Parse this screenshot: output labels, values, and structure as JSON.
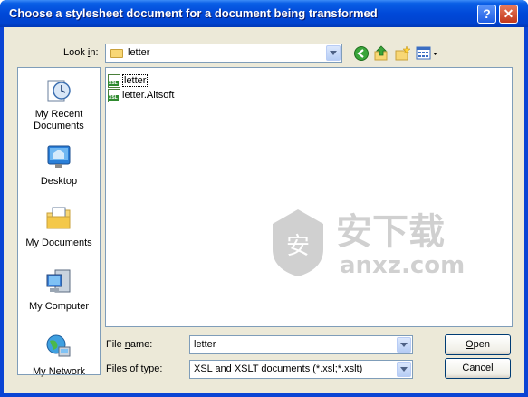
{
  "window": {
    "title": "Choose a stylesheet document for a document being transformed",
    "help_glyph": "?",
    "close_glyph": "✕"
  },
  "lookin": {
    "label_pre": "Look ",
    "label_u": "i",
    "label_post": "n:",
    "value": "letter"
  },
  "toolbar": {
    "icons": [
      "back-icon",
      "up-folder-icon",
      "new-folder-icon",
      "view-menu-icon"
    ]
  },
  "places": [
    {
      "label": "My Recent Documents",
      "icon": "recent-documents-icon"
    },
    {
      "label": "Desktop",
      "icon": "desktop-icon"
    },
    {
      "label": "My Documents",
      "icon": "my-documents-icon"
    },
    {
      "label": "My Computer",
      "icon": "my-computer-icon"
    },
    {
      "label": "My Network",
      "icon": "my-network-icon"
    }
  ],
  "files": [
    {
      "name": "letter",
      "selected": true
    },
    {
      "name": "letter.Altsoft",
      "selected": false
    }
  ],
  "watermark": {
    "cn": "安下载",
    "url": "anxz.com"
  },
  "filename": {
    "label_pre": "File ",
    "label_u": "n",
    "label_post": "ame:",
    "value": "letter"
  },
  "filetype": {
    "label_pre": "Files of ",
    "label_u": "t",
    "label_post": "ype:",
    "value": "XSL and XSLT documents (*.xsl;*.xslt)"
  },
  "buttons": {
    "open_u": "O",
    "open_rest": "pen",
    "cancel": "Cancel"
  },
  "colors": {
    "titlebar": "#0048d8",
    "dialog_bg": "#ece9d8",
    "field_border": "#7f9db9"
  }
}
